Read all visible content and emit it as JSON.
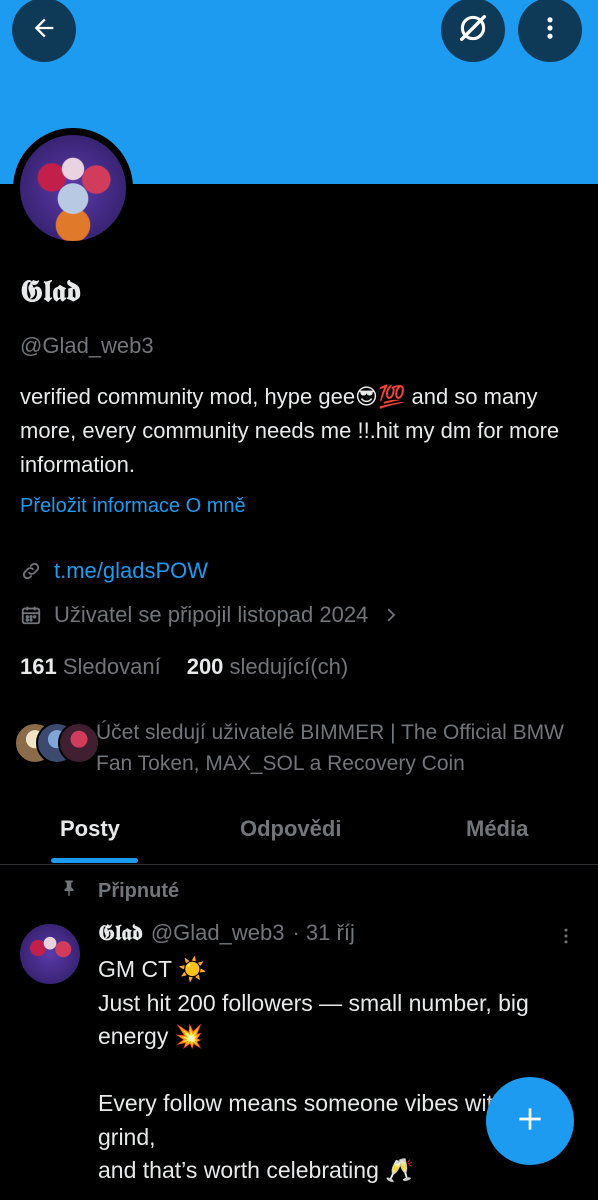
{
  "profile": {
    "display_name": "𝕲𝖑𝖆𝖉",
    "handle": "@Glad_web3",
    "bio": "verified community mod, hype gee😎💯 and so many more, every community needs me !!.hit my dm for more information.",
    "translate_label": "Přeložit informace O mně",
    "link": "t.me/gladsPOW",
    "joined": "Uživatel se připojil listopad 2024"
  },
  "stats": {
    "following_count": "161",
    "following_label": "Sledovaní",
    "followers_count": "200",
    "followers_label": "sledující(ch)"
  },
  "followed_by": {
    "text": "Účet sledují uživatelé BIMMER | The Official BMW Fan Token, MAX_SOL a Recovery Coin"
  },
  "tabs": [
    {
      "label": "Posty",
      "active": true
    },
    {
      "label": "Odpovědi",
      "active": false
    },
    {
      "label": "Média",
      "active": false
    }
  ],
  "pinned_post": {
    "pinned_label": "Připnuté",
    "author_name": "𝕲𝖑𝖆𝖉",
    "author_handle": "@Glad_web3",
    "time": "· 31 říj",
    "body": "GM CT ☀️\nJust hit 200 followers — small number, big energy 💥\n\nEvery follow means someone vibes with the grind,\nand that’s worth celebrating 🥂"
  },
  "colors": {
    "accent": "#1d9bf0",
    "banner": "#1d9bf0",
    "background": "#000000",
    "text_primary": "#e7e9ea",
    "text_secondary": "#71767b"
  },
  "icons": [
    "back-arrow-icon",
    "grok-icon",
    "more-vertical-icon",
    "link-icon",
    "calendar-icon",
    "chevron-right-icon",
    "pin-icon",
    "plus-icon"
  ]
}
